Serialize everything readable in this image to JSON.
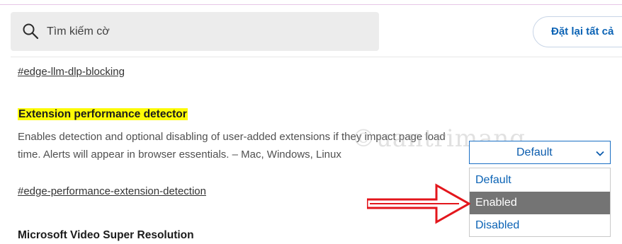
{
  "search": {
    "placeholder": "Tìm kiếm cờ"
  },
  "toolbar": {
    "reset_label": "Đặt lại tất cả"
  },
  "flags": {
    "previous": {
      "link": "#edge-llm-dlp-blocking"
    },
    "current": {
      "title": "Extension performance detector",
      "description": "Enables detection and optional disabling of user-added extensions if they impact page load time. Alerts will appear in browser essentials. – Mac, Windows, Linux",
      "link": "#edge-performance-extension-detection",
      "select_value": "Default",
      "options": [
        "Default",
        "Enabled",
        "Disabled"
      ],
      "highlighted_option": "Enabled"
    },
    "next": {
      "title": "Microsoft Video Super Resolution"
    }
  },
  "watermark": {
    "text": "©uantrimang"
  },
  "colors": {
    "title_highlight": "#fdfb07",
    "link_blue": "#0b63b5",
    "annotation_arrow": "#e3161c",
    "selected_option_bg": "#747474"
  },
  "icons": {
    "search": "search-icon",
    "select_chevron": "chevron-down-icon",
    "annotation": "red-arrow-icon"
  }
}
